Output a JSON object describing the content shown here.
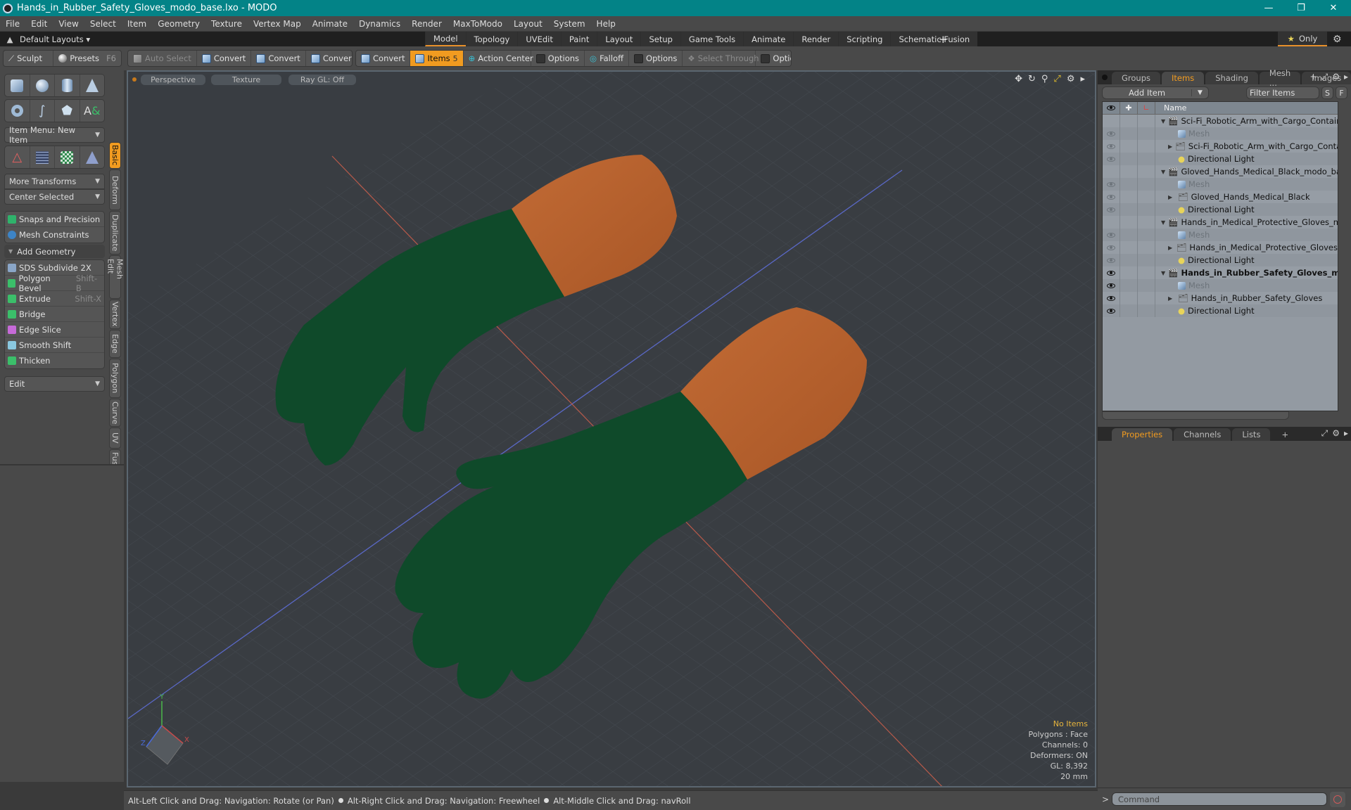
{
  "window": {
    "title": "Hands_in_Rubber_Safety_Gloves_modo_base.lxo - MODO",
    "controls": [
      "minimize",
      "restore",
      "close"
    ]
  },
  "menubar": [
    "File",
    "Edit",
    "View",
    "Select",
    "Item",
    "Geometry",
    "Texture",
    "Vertex Map",
    "Animate",
    "Dynamics",
    "Render",
    "MaxToModo",
    "Layout",
    "System",
    "Help"
  ],
  "layoutbar": {
    "layouts_label": "Default Layouts ▾",
    "tabs": [
      "Model",
      "Topology",
      "UVEdit",
      "Paint",
      "Layout",
      "Setup",
      "Game Tools",
      "Animate",
      "Render",
      "Scripting",
      "Schematic Fusion"
    ],
    "active_tab": "Model",
    "add_label": "+",
    "only_label": "Only"
  },
  "toolbar": {
    "sculpt": "Sculpt",
    "presets": "Presets",
    "presets_key": "F6",
    "auto_select": "Auto Select",
    "convert": "Convert",
    "items": "Items",
    "items_count": "5",
    "action_center": "Action Center",
    "options": "Options",
    "falloff": "Falloff",
    "select_through": "Select Through"
  },
  "leftpanel": {
    "item_menu": "Item Menu: New Item",
    "more_transforms": "More Transforms",
    "center_selected": "Center Selected",
    "snaps": "Snaps and Precision",
    "mesh_constraints": "Mesh Constraints",
    "add_geometry": "Add Geometry",
    "tools": [
      {
        "label": "SDS Subdivide 2X",
        "key": ""
      },
      {
        "label": "Polygon Bevel",
        "key": "Shift-B"
      },
      {
        "label": "Extrude",
        "key": "Shift-X"
      },
      {
        "label": "Bridge",
        "key": ""
      },
      {
        "label": "Edge Slice",
        "key": ""
      },
      {
        "label": "Smooth Shift",
        "key": ""
      },
      {
        "label": "Thicken",
        "key": ""
      }
    ],
    "edit_drop": "Edit",
    "vtabs": [
      "Basic",
      "Deform",
      "Duplicate",
      "Mesh Edit",
      "Vertex",
      "Edge",
      "Polygon",
      "Curve",
      "UV",
      "Fusion"
    ],
    "active_vtab": "Basic"
  },
  "viewport": {
    "view_mode": "Perspective",
    "shading": "Texture",
    "raygl": "Ray GL: Off",
    "info": {
      "selection": "No Items",
      "polygons": "Polygons : Face",
      "channels": "Channels: 0",
      "deformers": "Deformers: ON",
      "gl": "GL: 8,392",
      "unit": "20 mm"
    },
    "axis_labels": {
      "x": "X",
      "y": "Y",
      "z": "Z"
    },
    "colors": {
      "glove": "#0f4a2a",
      "cuff": "#b8622e",
      "bg": "#393d42"
    }
  },
  "statusbar": {
    "hints": [
      "Alt-Left Click and Drag: Navigation: Rotate (or Pan)",
      "Alt-Right Click and Drag: Navigation: Freewheel",
      "Alt-Middle Click and Drag: navRoll"
    ]
  },
  "rightpanel": {
    "tabs": [
      "Groups",
      "Items",
      "Shading",
      "Mesh ...",
      "Images"
    ],
    "active_tab": "Items",
    "add_item": "Add Item",
    "filter_placeholder": "Filter Items",
    "s_btn": "S",
    "f_btn": "F",
    "name_col": "Name",
    "tree": [
      {
        "level": 0,
        "label": "Sci-Fi_Robotic_Arm_with_Cargo_Container ...",
        "type": "scene",
        "eye": "",
        "expand": "▼",
        "style": ""
      },
      {
        "level": 1,
        "label": "Mesh",
        "type": "mesh",
        "eye": "off",
        "expand": "",
        "style": "muted"
      },
      {
        "level": 1,
        "label": "Sci-Fi_Robotic_Arm_with_Cargo_Container",
        "type": "group",
        "eye": "off",
        "expand": "▶",
        "style": ""
      },
      {
        "level": 1,
        "label": "Directional Light",
        "type": "light",
        "eye": "off",
        "expand": "",
        "style": ""
      },
      {
        "level": 0,
        "label": "Gloved_Hands_Medical_Black_modo_base.lxo",
        "type": "scene",
        "eye": "",
        "expand": "▼",
        "style": ""
      },
      {
        "level": 1,
        "label": "Mesh",
        "type": "mesh",
        "eye": "off",
        "expand": "",
        "style": "muted"
      },
      {
        "level": 1,
        "label": "Gloved_Hands_Medical_Black",
        "type": "group",
        "eye": "off",
        "expand": "▶",
        "style": ""
      },
      {
        "level": 1,
        "label": "Directional Light",
        "type": "light",
        "eye": "off",
        "expand": "",
        "style": ""
      },
      {
        "level": 0,
        "label": "Hands_in_Medical_Protective_Gloves_mod ...",
        "type": "scene",
        "eye": "",
        "expand": "▼",
        "style": ""
      },
      {
        "level": 1,
        "label": "Mesh",
        "type": "mesh",
        "eye": "off",
        "expand": "",
        "style": "muted"
      },
      {
        "level": 1,
        "label": "Hands_in_Medical_Protective_Gloves",
        "type": "group",
        "eye": "off",
        "expand": "▶",
        "style": ""
      },
      {
        "level": 1,
        "label": "Directional Light",
        "type": "light",
        "eye": "off",
        "expand": "",
        "style": ""
      },
      {
        "level": 0,
        "label": "Hands_in_Rubber_Safety_Gloves_m...",
        "type": "scene",
        "eye": "on",
        "expand": "▼",
        "style": "bold"
      },
      {
        "level": 1,
        "label": "Mesh",
        "type": "mesh",
        "eye": "on",
        "expand": "",
        "style": "muted"
      },
      {
        "level": 1,
        "label": "Hands_in_Rubber_Safety_Gloves",
        "type": "group",
        "eye": "on",
        "expand": "▶",
        "style": ""
      },
      {
        "level": 1,
        "label": "Directional Light",
        "type": "light",
        "eye": "on",
        "expand": "",
        "style": ""
      }
    ],
    "props_tabs": [
      "Properties",
      "Channels",
      "Lists"
    ],
    "active_props_tab": "Properties",
    "command_placeholder": "Command",
    "command_prompt": ">"
  }
}
